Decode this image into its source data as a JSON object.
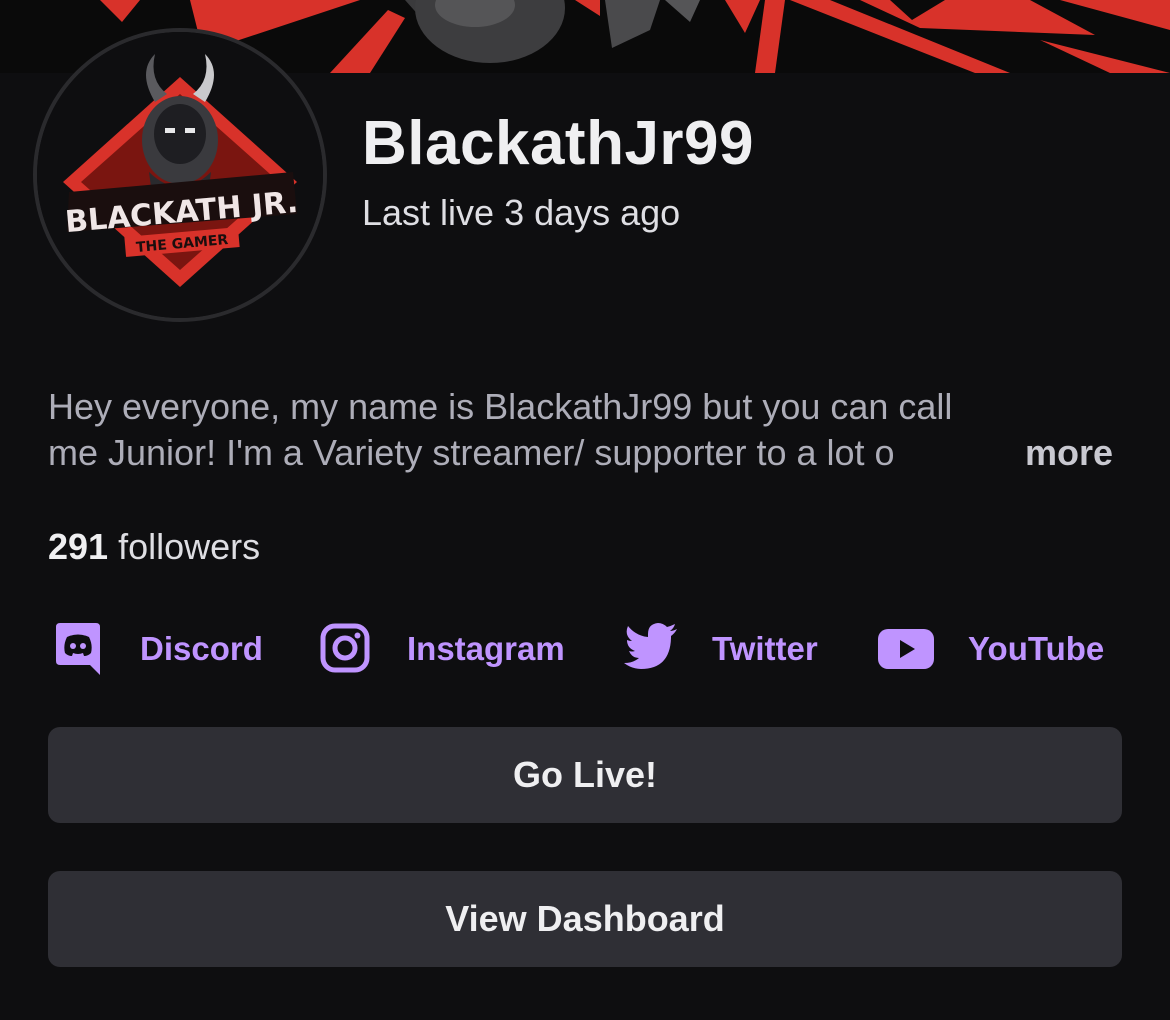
{
  "profile": {
    "username": "BlackathJr99",
    "last_live": "Last live 3 days ago",
    "avatar": {
      "main_text": "BLACKATH JR.",
      "sub_text": "THE GAMER"
    },
    "bio_line1": "Hey everyone, my name is BlackathJr99 but you can call",
    "bio_line2": "me Junior! I'm a Variety streamer/ supporter to a lot o",
    "more_label": "more",
    "followers_count": "291",
    "followers_label": "followers"
  },
  "socials": [
    {
      "label": "Discord",
      "icon": "discord-icon"
    },
    {
      "label": "Instagram",
      "icon": "instagram-icon"
    },
    {
      "label": "Twitter",
      "icon": "twitter-icon"
    },
    {
      "label": "YouTube",
      "icon": "youtube-icon"
    }
  ],
  "buttons": {
    "go_live": "Go Live!",
    "view_dashboard": "View Dashboard"
  },
  "colors": {
    "background": "#0e0e10",
    "accent": "#bf94ff",
    "button": "#2f2f35",
    "banner_red": "#d8322a"
  }
}
